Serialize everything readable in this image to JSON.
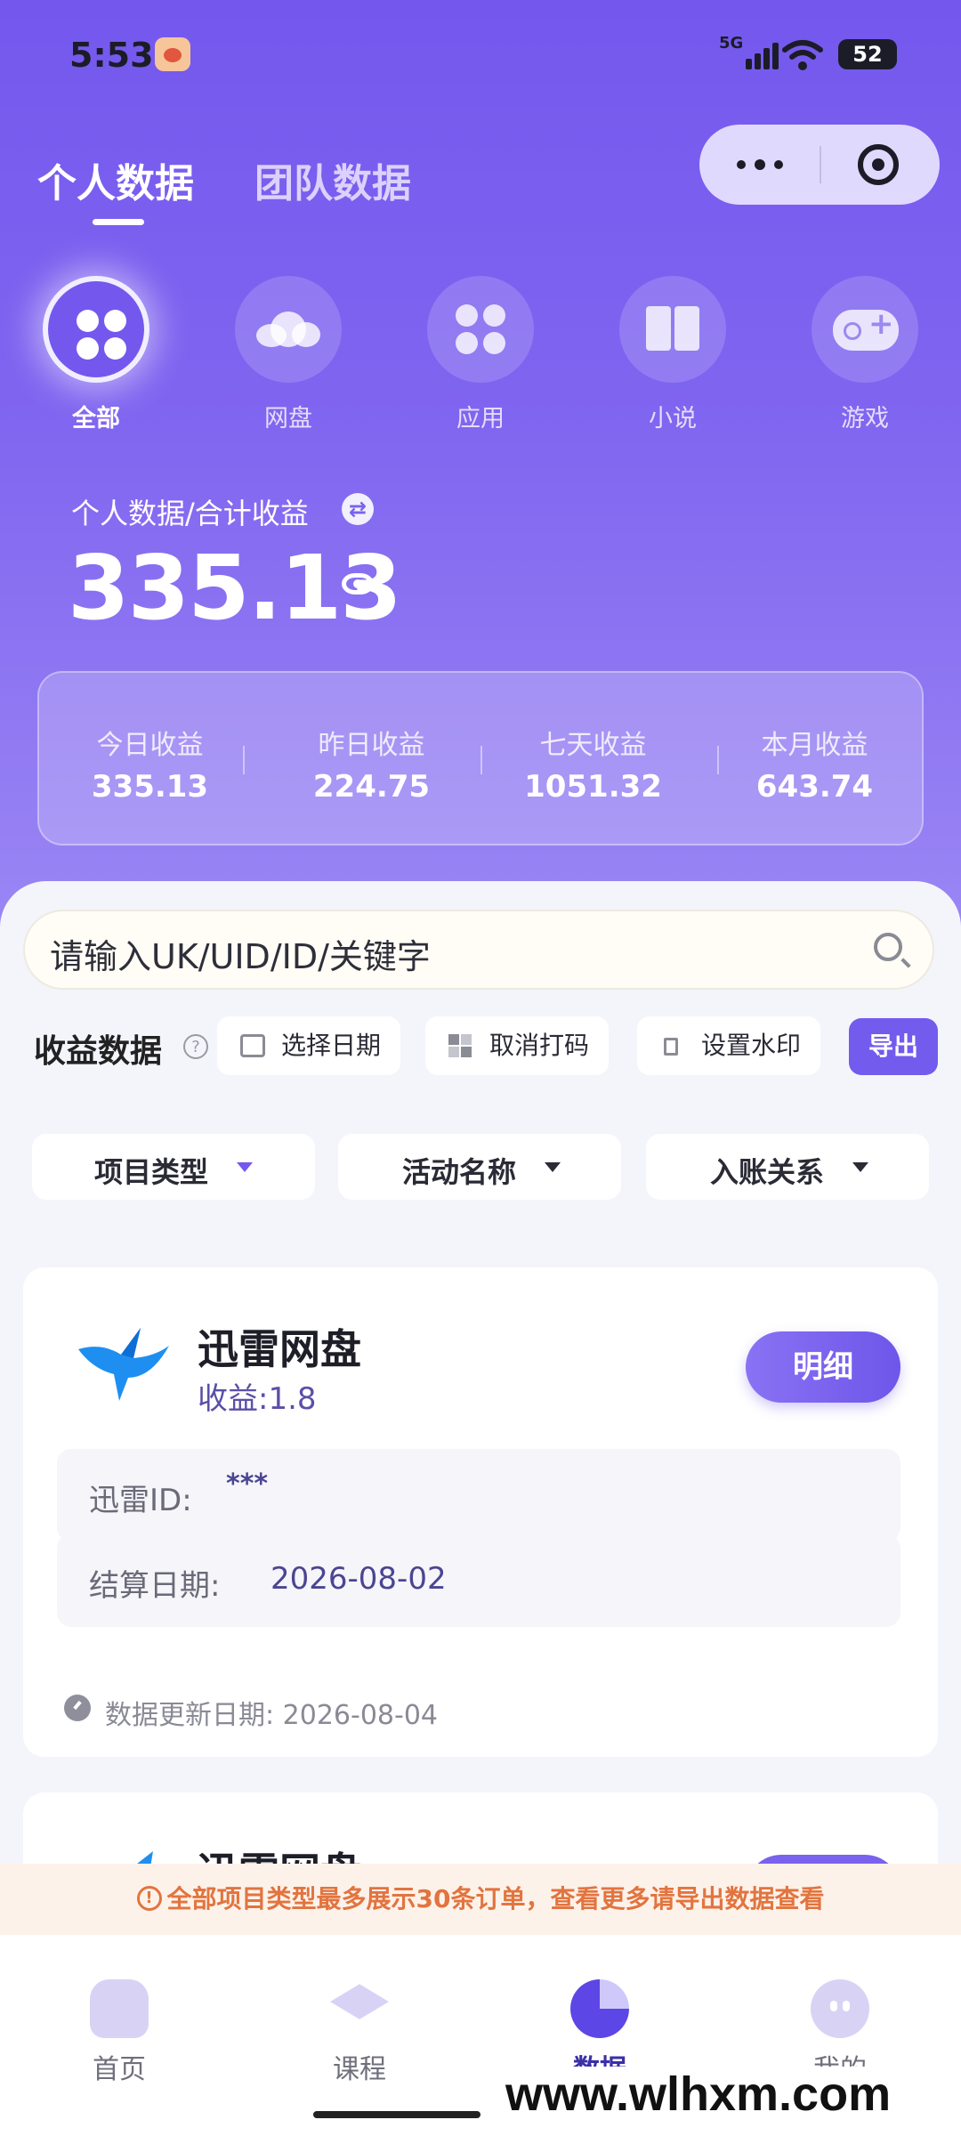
{
  "status_bar": {
    "time": "5:53",
    "network": "5G",
    "battery": "52"
  },
  "header": {
    "tabs": [
      {
        "label": "个人数据",
        "active": true
      },
      {
        "label": "团队数据",
        "active": false
      }
    ]
  },
  "categories": [
    {
      "label": "全部",
      "icon": "clover-icon",
      "active": true
    },
    {
      "label": "网盘",
      "icon": "cloud-icon"
    },
    {
      "label": "应用",
      "icon": "apps-icon"
    },
    {
      "label": "小说",
      "icon": "book-icon"
    },
    {
      "label": "游戏",
      "icon": "gamepad-icon"
    }
  ],
  "summary": {
    "label": "个人数据/合计收益",
    "total": "335.13",
    "stats": [
      {
        "label": "今日收益",
        "value": "335.13"
      },
      {
        "label": "昨日收益",
        "value": "224.75"
      },
      {
        "label": "七天收益",
        "value": "1051.32"
      },
      {
        "label": "本月收益",
        "value": "643.74"
      }
    ]
  },
  "search": {
    "placeholder": "请输入UK/UID/ID/关键字"
  },
  "section": {
    "title": "收益数据",
    "tools": {
      "date": "选择日期",
      "unmask": "取消打码",
      "watermark": "设置水印",
      "export": "导出"
    },
    "filters": [
      "项目类型",
      "活动名称",
      "入账关系"
    ]
  },
  "records": [
    {
      "title": "迅雷网盘",
      "income": "收益:1.8",
      "detail": "明细",
      "id_label": "迅雷ID:",
      "id_value": "***",
      "settle_label": "结算日期:",
      "settle_value": "2026-08-02",
      "update_text": "数据更新日期: 2026-08-04"
    },
    {
      "title": "迅雷网盘"
    }
  ],
  "notice": "全部项目类型最多展示30条订单，查看更多请导出数据查看",
  "tabbar": [
    {
      "label": "首页"
    },
    {
      "label": "课程"
    },
    {
      "label": "数据",
      "active": true
    },
    {
      "label": "我的"
    }
  ],
  "watermark": "www.wlhxm.com",
  "colors": {
    "primary": "#7458ee",
    "notice": "#e2743f"
  }
}
